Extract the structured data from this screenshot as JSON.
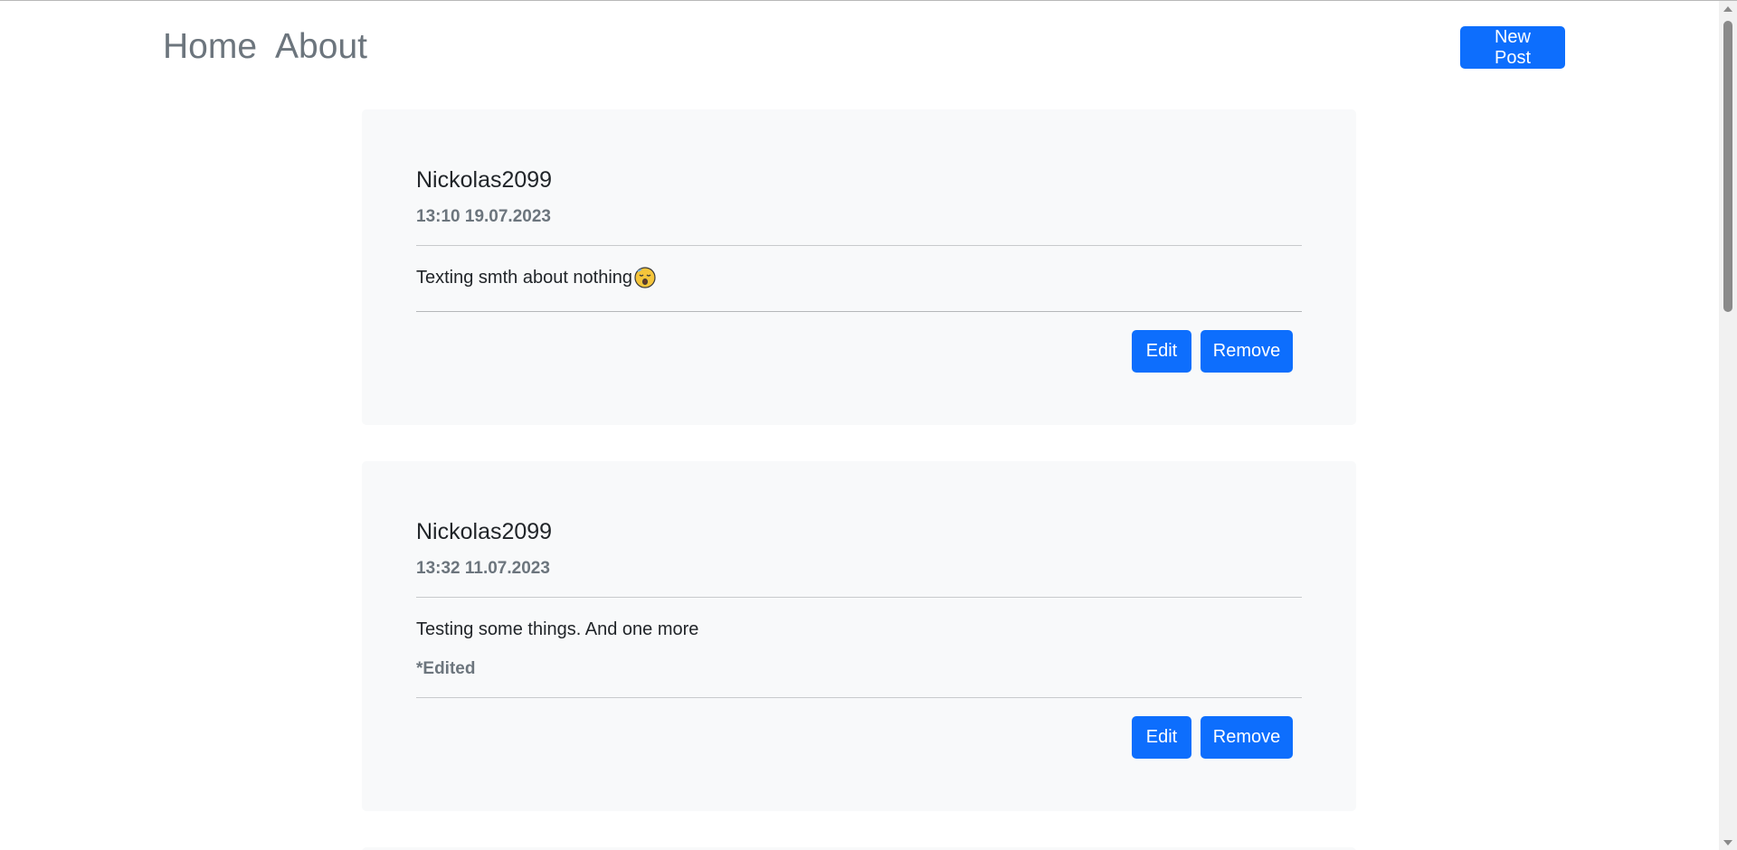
{
  "nav": {
    "links": [
      {
        "label": "Home"
      },
      {
        "label": "About"
      }
    ],
    "new_post_label": "New Post"
  },
  "posts": [
    {
      "author": "Nickolas2099",
      "datetime": "13:10 19.07.2023",
      "body": "Texting smth about nothing",
      "body_emoji": "sleeping-face-icon",
      "edited": "",
      "edit_label": "Edit",
      "remove_label": "Remove"
    },
    {
      "author": "Nickolas2099",
      "datetime": "13:32 11.07.2023",
      "body": "Testing some things. And one more",
      "edited": "*Edited",
      "edit_label": "Edit",
      "remove_label": "Remove"
    }
  ],
  "colors": {
    "primary": "#0d6efd",
    "card_bg": "#f8f9fa",
    "muted": "#6c757d",
    "text": "#212529"
  }
}
